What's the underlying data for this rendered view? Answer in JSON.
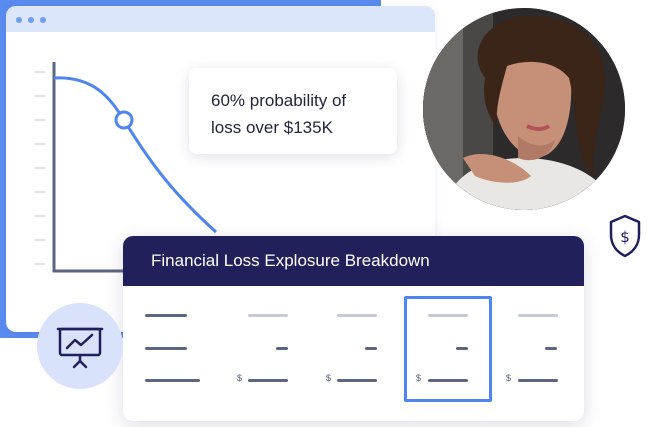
{
  "colors": {
    "brand_blue": "#5a8bf0",
    "navy": "#22205a",
    "line_dark": "#5c6680",
    "line_light": "#c6cad6",
    "highlight": "#4e86ee"
  },
  "chart": {
    "curve": "decreasing-s-curve",
    "marker": "circle-marker"
  },
  "tooltip": {
    "line1": "60% probability of",
    "line2": "loss over $135K"
  },
  "card": {
    "title": "Financial Loss Explosure Breakdown",
    "currency_symbol": "$",
    "highlighted_column": 3
  },
  "icons": {
    "shield": "shield-dollar-icon",
    "presentation": "presentation-chart-icon"
  }
}
